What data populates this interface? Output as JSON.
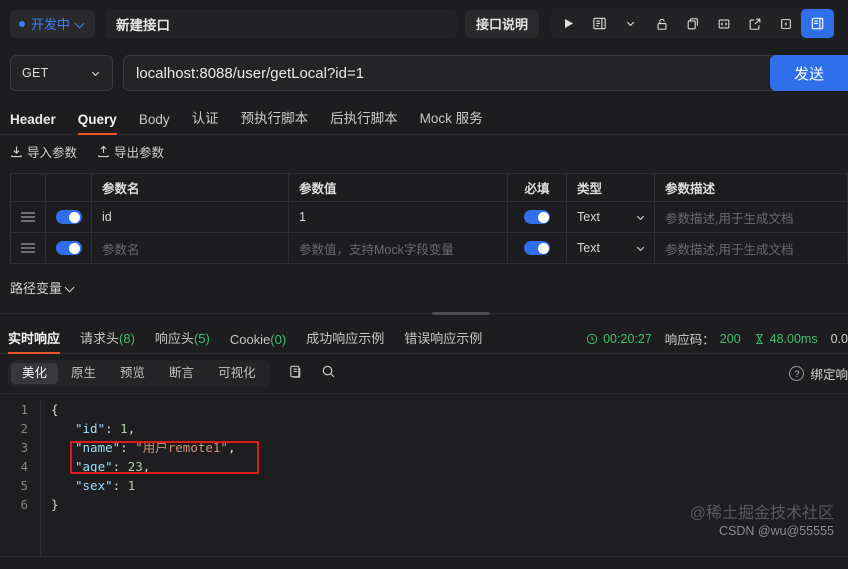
{
  "topbar": {
    "status_label": "开发中",
    "api_title": "新建接口",
    "desc_button": "接口说明",
    "icons": [
      "play-icon",
      "doc-list-icon",
      "chevron-down-icon",
      "unlock-icon",
      "duplicate-icon",
      "code-brackets-icon",
      "share-export-icon",
      "flash-icon",
      "save-icon"
    ]
  },
  "url_row": {
    "method": "GET",
    "url": "localhost:8088/user/getLocal?id=1",
    "send_label": "发送"
  },
  "request_tabs": [
    {
      "label": "Header",
      "active": false
    },
    {
      "label": "Query",
      "active": true
    },
    {
      "label": "Body",
      "active": false
    },
    {
      "label": "认证",
      "active": false
    },
    {
      "label": "预执行脚本",
      "active": false
    },
    {
      "label": "后执行脚本",
      "active": false
    },
    {
      "label": "Mock 服务",
      "active": false
    }
  ],
  "param_actions": [
    {
      "label": "导入参数",
      "icon": "import-icon"
    },
    {
      "label": "导出参数",
      "icon": "export-icon"
    }
  ],
  "param_table": {
    "headers": {
      "name": "参数名",
      "value": "参数值",
      "required": "必填",
      "type": "类型",
      "desc": "参数描述"
    },
    "rows": [
      {
        "enabled": true,
        "name": "id",
        "name_placeholder": "",
        "value": "1",
        "value_placeholder": "",
        "required": true,
        "type": "Text",
        "desc": "",
        "desc_placeholder": "参数描述,用于生成文档"
      },
      {
        "enabled": true,
        "name": "",
        "name_placeholder": "参数名",
        "value": "",
        "value_placeholder": "参数值，支持Mock字段变量",
        "required": true,
        "type": "Text",
        "desc": "",
        "desc_placeholder": "参数描述,用于生成文档"
      }
    ]
  },
  "path_variable": {
    "label": "路径变量"
  },
  "response_tabs": [
    {
      "label": "实时响应",
      "count": "",
      "active": true
    },
    {
      "label": "请求头",
      "count": "(8)",
      "active": false
    },
    {
      "label": "响应头",
      "count": "(5)",
      "active": false
    },
    {
      "label": "Cookie",
      "count": "(0)",
      "active": false
    },
    {
      "label": "成功响应示例",
      "count": "",
      "active": false
    },
    {
      "label": "错误响应示例",
      "count": "",
      "active": false
    }
  ],
  "response_meta": {
    "time": "00:20:27",
    "status_label": "响应码：",
    "status_code": "200",
    "duration": "48.00ms",
    "size": "0.0"
  },
  "viewer": {
    "tabs": [
      {
        "label": "美化",
        "active": true
      },
      {
        "label": "原生",
        "active": false
      },
      {
        "label": "预览",
        "active": false
      },
      {
        "label": "断言",
        "active": false
      },
      {
        "label": "可视化",
        "active": false
      }
    ],
    "copy_icon": "copy-icon",
    "search_icon": "search-icon",
    "bind_label": "绑定响"
  },
  "code": {
    "lines": [
      {
        "num": "1",
        "tokens": [
          {
            "t": "{",
            "c": "pun"
          }
        ]
      },
      {
        "num": "2",
        "indent": 1,
        "tokens": [
          {
            "t": "\"id\"",
            "c": "key"
          },
          {
            "t": ": ",
            "c": "pun"
          },
          {
            "t": "1",
            "c": "num"
          },
          {
            "t": ",",
            "c": "pun"
          }
        ]
      },
      {
        "num": "3",
        "indent": 1,
        "tokens": [
          {
            "t": "\"name\"",
            "c": "key"
          },
          {
            "t": ": ",
            "c": "pun"
          },
          {
            "t": "\"用户remote1\"",
            "c": "str"
          },
          {
            "t": ",",
            "c": "pun"
          }
        ]
      },
      {
        "num": "4",
        "indent": 1,
        "tokens": [
          {
            "t": "\"age\"",
            "c": "key"
          },
          {
            "t": ": ",
            "c": "pun"
          },
          {
            "t": "23",
            "c": "num"
          },
          {
            "t": ",",
            "c": "pun"
          }
        ]
      },
      {
        "num": "5",
        "indent": 1,
        "tokens": [
          {
            "t": "\"sex\"",
            "c": "key"
          },
          {
            "t": ": ",
            "c": "pun"
          },
          {
            "t": "1",
            "c": "num"
          }
        ]
      },
      {
        "num": "6",
        "tokens": [
          {
            "t": "}",
            "c": "pun"
          }
        ]
      }
    ]
  },
  "watermark": {
    "main": "@稀土掘金技术社区",
    "sub": "CSDN @wu@55555"
  },
  "colors": {
    "accent_blue": "#2f6fec",
    "tab_underline": "#e8572a",
    "status_green": "#3fbf6e",
    "annotation_red": "#e01b1b"
  }
}
